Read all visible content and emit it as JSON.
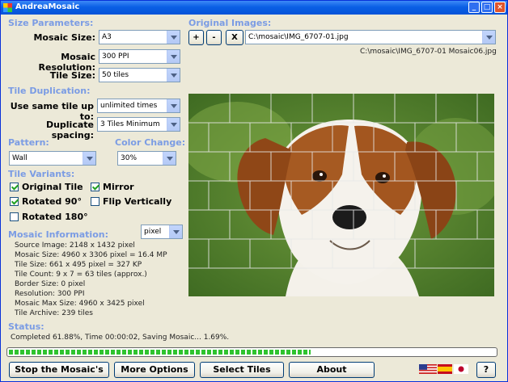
{
  "window": {
    "title": "AndreaMosaic"
  },
  "sections": {
    "size_parameters": "Size Parameters:",
    "tile_duplication": "Tile Duplication:",
    "pattern": "Pattern:",
    "color_change": "Color Change:",
    "tile_variants": "Tile Variants:",
    "mosaic_information": "Mosaic Information:",
    "original_images": "Original Images:",
    "status": "Status:"
  },
  "size": {
    "mosaic_size_label": "Mosaic Size:",
    "mosaic_size": "A3",
    "resolution_label": "Mosaic Resolution:",
    "resolution": "300 PPI",
    "tile_size_label": "Tile Size:",
    "tile_size": "50 tiles"
  },
  "duplication": {
    "same_tile_label": "Use same tile up to:",
    "same_tile": "unlimited times",
    "spacing_label": "Duplicate spacing:",
    "spacing": "3 Tiles Minimum"
  },
  "pattern": {
    "value": "Wall"
  },
  "color_change": {
    "value": "30%"
  },
  "variants": {
    "original_tile": "Original Tile",
    "mirror": "Mirror",
    "rotated90": "Rotated 90°",
    "flip_vertically": "Flip Vertically",
    "rotated180": "Rotated 180°"
  },
  "info": {
    "unit": "pixel",
    "lines": [
      "Source Image: 2148 x 1432 pixel",
      "Mosaic Size: 4960 x 3306 pixel = 16.4 MP",
      "Tile Size: 661 x 495 pixel = 327 KP",
      "Tile Count: 9 x 7 = 63 tiles (approx.)",
      "Border Size: 0 pixel",
      "Resolution: 300 PPI",
      "Mosaic Max Size: 4960 x 3425 pixel",
      "Tile Archive: 239 tiles"
    ]
  },
  "images": {
    "add": "+",
    "remove": "-",
    "clear": "X",
    "path": "C:\\mosaic\\IMG_6707-01.jpg",
    "output": "C:\\mosaic\\IMG_6707-01 Mosaic06.jpg"
  },
  "status": {
    "text": "Completed 61.88%, Time 00:00:02, Saving Mosaic... 1.69%.",
    "progress": 0.62
  },
  "buttons": {
    "stop": "Stop the Mosaic's",
    "more_options": "More Options",
    "select_tiles": "Select Tiles",
    "about": "About",
    "help": "?"
  }
}
